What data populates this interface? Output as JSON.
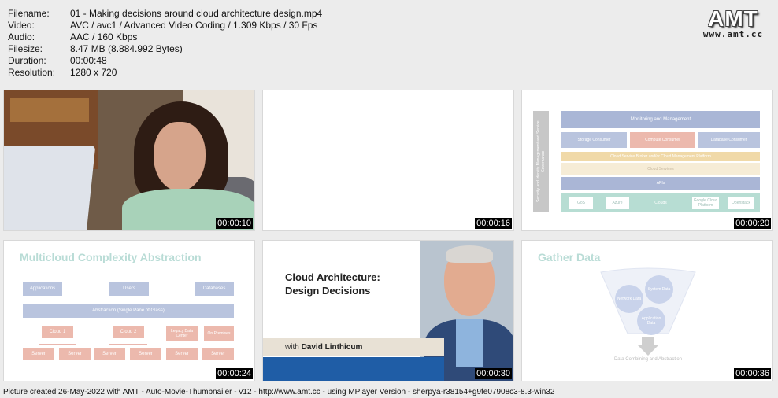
{
  "meta": {
    "rows": [
      {
        "key": "Filename:",
        "value": "01 - Making decisions around cloud architecture design.mp4"
      },
      {
        "key": "Video:",
        "value": "AVC / avc1 / Advanced Video Coding / 1.309 Kbps / 30 Fps"
      },
      {
        "key": "Audio:",
        "value": "AAC / 160 Kbps"
      },
      {
        "key": "Filesize:",
        "value": "8.47 MB (8.884.992 Bytes)"
      },
      {
        "key": "Duration:",
        "value": "00:00:48"
      },
      {
        "key": "Resolution:",
        "value": "1280 x 720"
      }
    ]
  },
  "logo": {
    "main": "AMT",
    "url": "www.amt.cc"
  },
  "thumbs": [
    {
      "time": "00:00:10"
    },
    {
      "time": "00:00:16"
    },
    {
      "time": "00:00:20"
    },
    {
      "time": "00:00:24"
    },
    {
      "time": "00:00:30"
    },
    {
      "time": "00:00:36"
    }
  ],
  "slide3": {
    "monitoring": "Monitoring and Management",
    "storage": "Storage Consumer",
    "compute": "Compute Consumer",
    "database": "Database Consumer",
    "broker": "Cloud Service Broker and/or Cloud Management Platform",
    "services": "Cloud Services",
    "apis": "APIs",
    "clouds": "Clouds",
    "side": "Security and Identity Management and Service Governance",
    "c1": "GoS",
    "c2": "Azure",
    "c3": "Google Cloud Platform",
    "c4": "Openstack"
  },
  "slide4": {
    "title": "Multicloud Complexity Abstraction",
    "applications": "Applications",
    "users": "Users",
    "databases": "Databases",
    "abstraction": "Abstraction (Single Pane of Glass)",
    "cloud1": "Cloud 1",
    "cloud2": "Cloud 2",
    "legacy": "Legacy Data Center",
    "onprem": "On Premises",
    "server": "Server"
  },
  "slide5": {
    "title_line1": "Cloud Architecture:",
    "title_line2": "Design Decisions",
    "with": "with",
    "author": "David Linthicum"
  },
  "slide6": {
    "title": "Gather Data",
    "network": "Network Data",
    "system": "System Data",
    "application": "Application Data",
    "caption": "Data Combining and Abstraction"
  },
  "footer": "Picture created 26-May-2022 with AMT - Auto-Movie-Thumbnailer - v12 - http://www.amt.cc - using MPlayer Version - sherpya-r38154+g9fe07908c3-8.3-win32"
}
